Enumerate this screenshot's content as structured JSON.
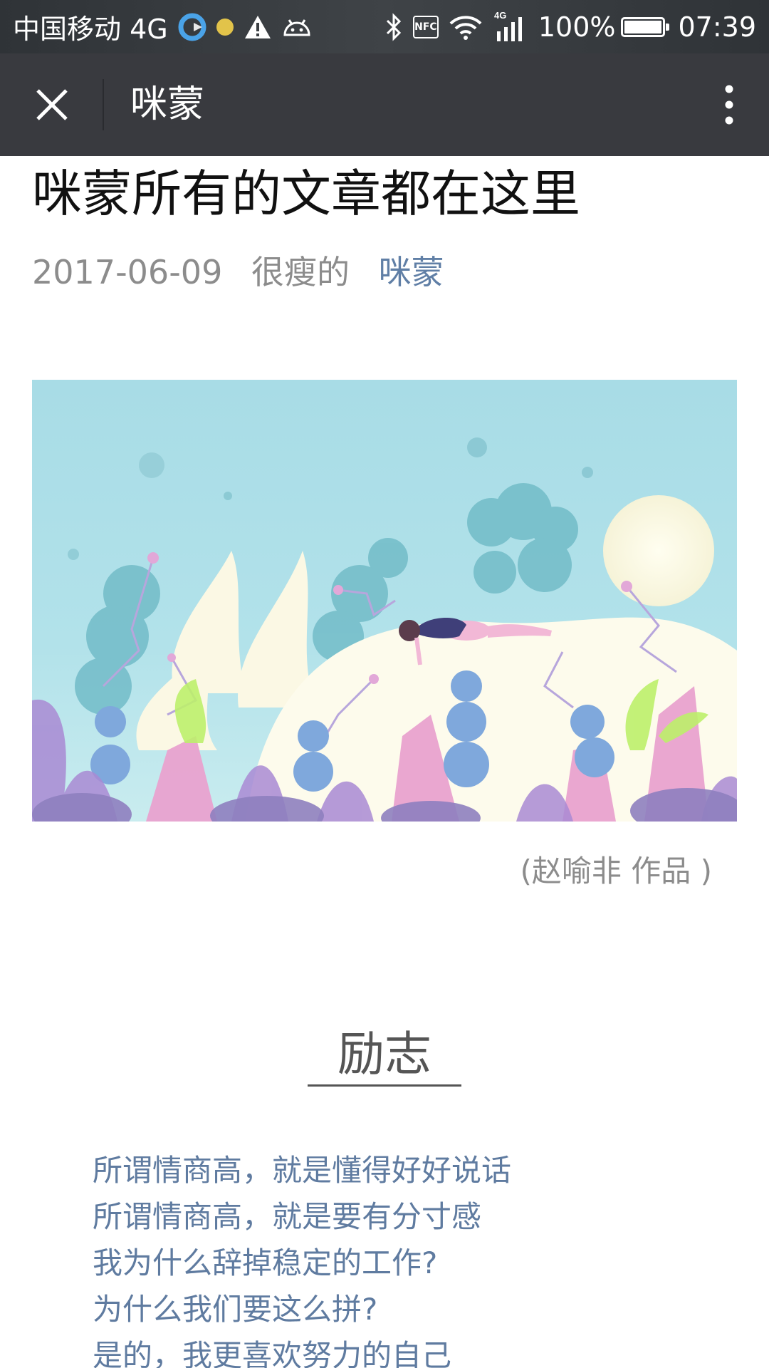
{
  "status_bar": {
    "carrier": "中国移动 4G",
    "network_badge": "4G",
    "nfc_label": "NFC",
    "battery_level": 1.0,
    "battery_text": "100%",
    "time": "07:39",
    "icons": [
      "browser-app-icon",
      "notification-dot-icon",
      "warning-icon",
      "android-icon",
      "bluetooth-icon",
      "nfc-icon",
      "wifi-icon",
      "signal-icon",
      "battery-icon"
    ],
    "dot_color": "#e2c34a"
  },
  "title_bar": {
    "title": "咪蒙",
    "background": "#393a3f"
  },
  "article": {
    "title": "咪蒙所有的文章都在这里",
    "date": "2017-06-09",
    "author": "很瘦的",
    "account": "咪蒙",
    "link_color": "#607fa6",
    "image_caption": "(赵喻非 作品 )"
  },
  "section": {
    "heading": "励志",
    "items": [
      "所谓情商高，就是懂得好好说话",
      "所谓情商高，就是要有分寸感",
      "我为什么辞掉稳定的工作?",
      "为什么我们要这么拼?",
      "是的，我更喜欢努力的自己"
    ]
  }
}
